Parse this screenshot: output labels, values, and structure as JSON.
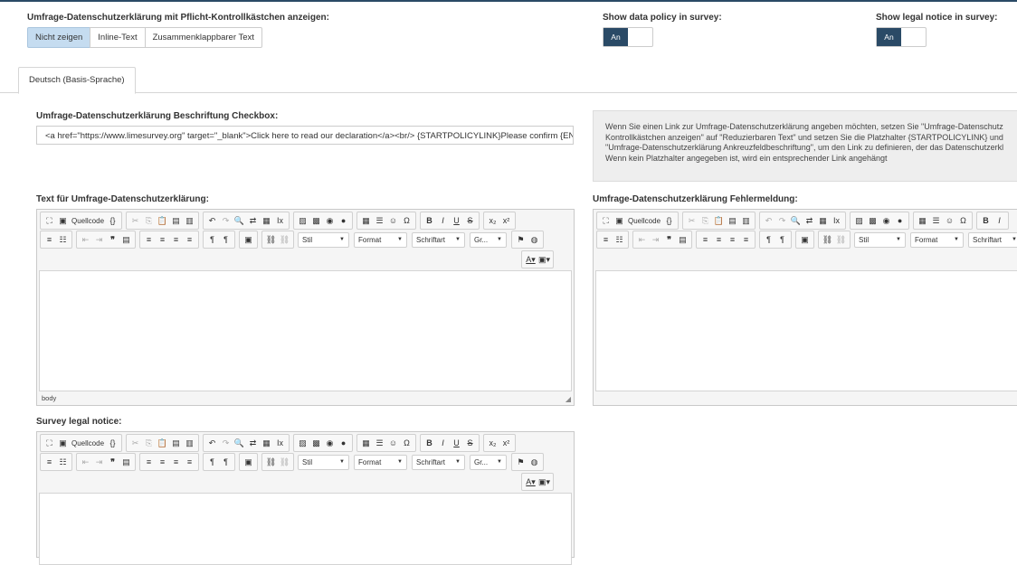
{
  "top": {
    "show_policy_label": "Umfrage-Datenschutzerklärung mit Pflicht-Kontrollkästchen anzeigen:",
    "policy_buttons": [
      "Nicht zeigen",
      "Inline-Text",
      "Zusammenklappbarer Text"
    ],
    "data_policy_label": "Show data policy in survey:",
    "legal_notice_label": "Show legal notice in survey:",
    "toggle_on_label": "An"
  },
  "tabs": [
    "Deutsch (Basis-Sprache)"
  ],
  "checkbox_label": {
    "label": "Umfrage-Datenschutzerklärung Beschriftung Checkbox:",
    "value": "<a href=\"https://www.limesurvey.org\" target=\"_blank\">Click here to read our declaration</a><br/> {STARTPOLICYLINK}Please confirm {ENI"
  },
  "info": {
    "lines": [
      "Wenn Sie einen Link zur Umfrage-Datenschutzerklärung angeben möchten, setzen Sie \"Umfrage-Datenschutz",
      "Kontrollkästchen anzeigen\" auf \"Reduzierbaren Text\" und setzen Sie die Platzhalter {STARTPOLICYLINK} und",
      "\"Umfrage-Datenschutzerklärung Ankreuzfeldbeschriftung\", um den Link zu definieren, der das Datenschutzerkl",
      "Wenn kein Platzhalter angegeben ist, wird ein entsprechender Link angehängt"
    ]
  },
  "editors": {
    "policy_text_label": "Text für Umfrage-Datenschutzerklärung:",
    "policy_error_label": "Umfrage-Datenschutzerklärung Fehlermeldung:",
    "legal_notice_label": "Survey legal notice:",
    "source_label": "Quellcode",
    "style_combo": "Stil",
    "format_combo": "Format",
    "font_combo": "Schriftart",
    "size_combo": "Gr...",
    "path": "body"
  }
}
